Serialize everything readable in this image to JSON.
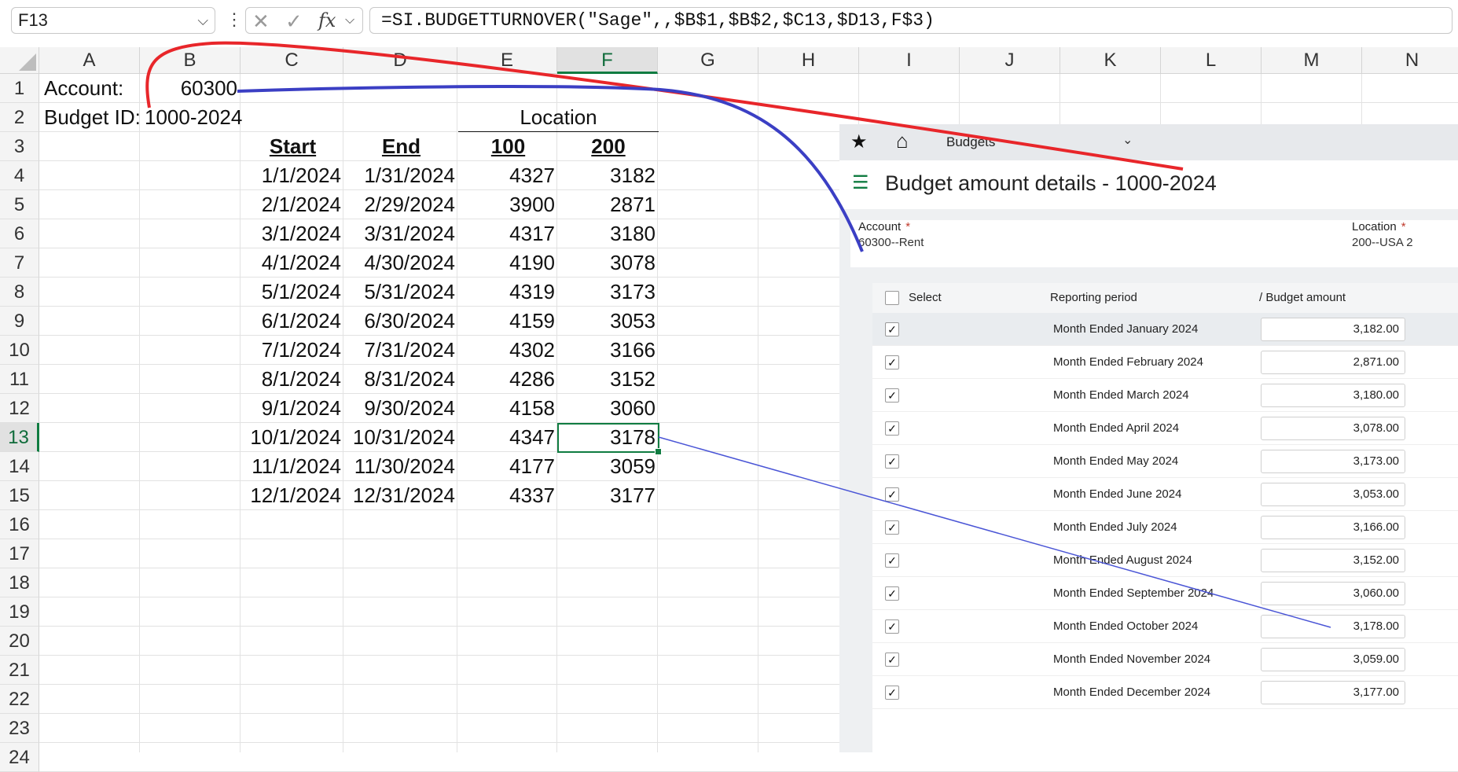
{
  "formula_bar": {
    "name_box": "F13",
    "formula": "=SI.BUDGETTURNOVER(\"Sage\",,$B$1,$B$2,$C13,$D13,F$3)"
  },
  "sheet": {
    "columns": [
      "A",
      "B",
      "C",
      "D",
      "E",
      "F",
      "G",
      "H",
      "I",
      "J",
      "K",
      "L",
      "M",
      "N"
    ],
    "rows": [
      "1",
      "2",
      "3",
      "4",
      "5",
      "6",
      "7",
      "8",
      "9",
      "10",
      "11",
      "12",
      "13",
      "14",
      "15",
      "16",
      "17",
      "18",
      "19",
      "20",
      "21",
      "22",
      "23",
      "24"
    ],
    "account_label": "Account:",
    "account_value": "60300",
    "budget_label": "Budget ID:",
    "budget_value": "1000-2024",
    "location_label": "Location",
    "headers": {
      "start": "Start",
      "end": "End",
      "loc100": "100",
      "loc200": "200"
    },
    "data": [
      [
        "1/1/2024",
        "1/31/2024",
        "4327",
        "3182"
      ],
      [
        "2/1/2024",
        "2/29/2024",
        "3900",
        "2871"
      ],
      [
        "3/1/2024",
        "3/31/2024",
        "4317",
        "3180"
      ],
      [
        "4/1/2024",
        "4/30/2024",
        "4190",
        "3078"
      ],
      [
        "5/1/2024",
        "5/31/2024",
        "4319",
        "3173"
      ],
      [
        "6/1/2024",
        "6/30/2024",
        "4159",
        "3053"
      ],
      [
        "7/1/2024",
        "7/31/2024",
        "4302",
        "3166"
      ],
      [
        "8/1/2024",
        "8/31/2024",
        "4286",
        "3152"
      ],
      [
        "9/1/2024",
        "9/30/2024",
        "4158",
        "3060"
      ],
      [
        "10/1/2024",
        "10/31/2024",
        "4347",
        "3178"
      ],
      [
        "11/1/2024",
        "11/30/2024",
        "4177",
        "3059"
      ],
      [
        "12/1/2024",
        "12/31/2024",
        "4337",
        "3177"
      ]
    ]
  },
  "panel": {
    "tab_label": "Budgets",
    "title": "Budget amount details - 1000-2024",
    "account_label": "Account",
    "account_value": "60300--Rent",
    "location_label": "Location",
    "location_value": "200--USA 2",
    "col_select": "Select",
    "col_period": "Reporting period",
    "col_amount": "/ Budget amount",
    "rows": [
      {
        "period": "Month Ended January 2024",
        "amount": "3,182.00"
      },
      {
        "period": "Month Ended February 2024",
        "amount": "2,871.00"
      },
      {
        "period": "Month Ended March 2024",
        "amount": "3,180.00"
      },
      {
        "period": "Month Ended April 2024",
        "amount": "3,078.00"
      },
      {
        "period": "Month Ended May 2024",
        "amount": "3,173.00"
      },
      {
        "period": "Month Ended June 2024",
        "amount": "3,053.00"
      },
      {
        "period": "Month Ended July 2024",
        "amount": "3,166.00"
      },
      {
        "period": "Month Ended August 2024",
        "amount": "3,152.00"
      },
      {
        "period": "Month Ended September 2024",
        "amount": "3,060.00"
      },
      {
        "period": "Month Ended October 2024",
        "amount": "3,178.00"
      },
      {
        "period": "Month Ended November 2024",
        "amount": "3,059.00"
      },
      {
        "period": "Month Ended December 2024",
        "amount": "3,177.00"
      }
    ]
  },
  "colors": {
    "excel_green": "#107c41",
    "red_arrow": "#e8262a",
    "blue_arrow": "#3b3fc4",
    "thin_blue": "#4a55d6"
  }
}
